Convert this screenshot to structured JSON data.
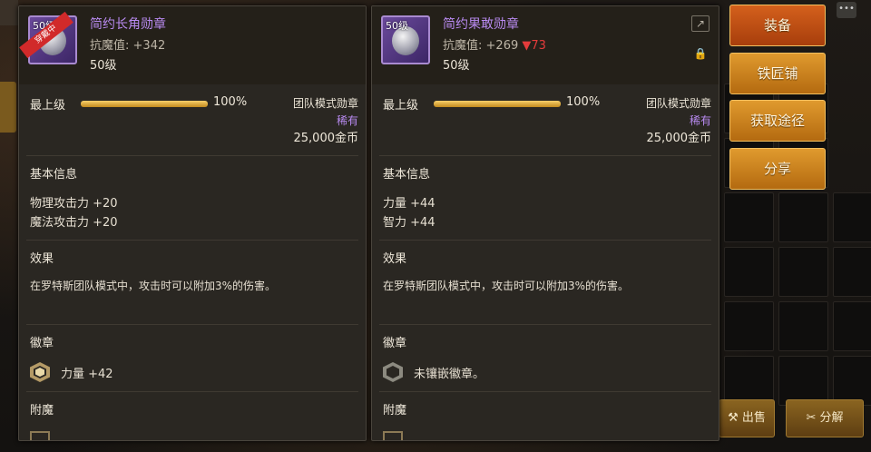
{
  "background": {
    "chat_icon": "•••",
    "bottom_buttons": [
      {
        "label": "出售",
        "icon": "hammer-icon"
      },
      {
        "label": "分解",
        "icon": "disassemble-icon"
      }
    ]
  },
  "left_panel": {
    "level_badge": "50级",
    "equip_tag": "穿戴中",
    "name": "简约长角勋章",
    "stat_label": "抗魔值:",
    "stat_value": "+342",
    "level": "50级",
    "max_level_label": "最上级",
    "max_level_progress": 100,
    "max_level_pct": "100%",
    "mode": "团队模式勋章",
    "rarity": "稀有",
    "price": "25,000金币",
    "basic_title": "基本信息",
    "basic_lines": [
      "物理攻击力 +20",
      "魔法攻击力 +20"
    ],
    "effect_title": "效果",
    "effect_text": "在罗特斯团队模式中，攻击时可以附加3%的伤害。",
    "emblem_title": "徽章",
    "emblem_text": "力量 +42",
    "enchant_title": "附魔"
  },
  "right_panel": {
    "level_badge": "50级",
    "name": "简约果敢勋章",
    "stat_label": "抗魔值:",
    "stat_value": "+269",
    "stat_diff": "▼73",
    "level": "50级",
    "max_level_label": "最上级",
    "max_level_progress": 100,
    "max_level_pct": "100%",
    "mode": "团队模式勋章",
    "rarity": "稀有",
    "price": "25,000金币",
    "basic_title": "基本信息",
    "basic_lines": [
      "力量 +44",
      "智力 +44"
    ],
    "effect_title": "效果",
    "effect_text": "在罗特斯团队模式中，攻击时可以附加3%的伤害。",
    "emblem_title": "徽章",
    "emblem_text": "未镶嵌徽章。",
    "enchant_title": "附魔",
    "share_icon": "↗",
    "lock_icon": "🔒"
  },
  "actions": [
    {
      "label": "装备"
    },
    {
      "label": "铁匠铺"
    },
    {
      "label": "获取途径"
    },
    {
      "label": "分享"
    }
  ],
  "colors": {
    "item_name": "#b88af0",
    "rarity": "#b88af0",
    "decrease": "#e43b3b",
    "button_orange": "#e09a2e"
  }
}
